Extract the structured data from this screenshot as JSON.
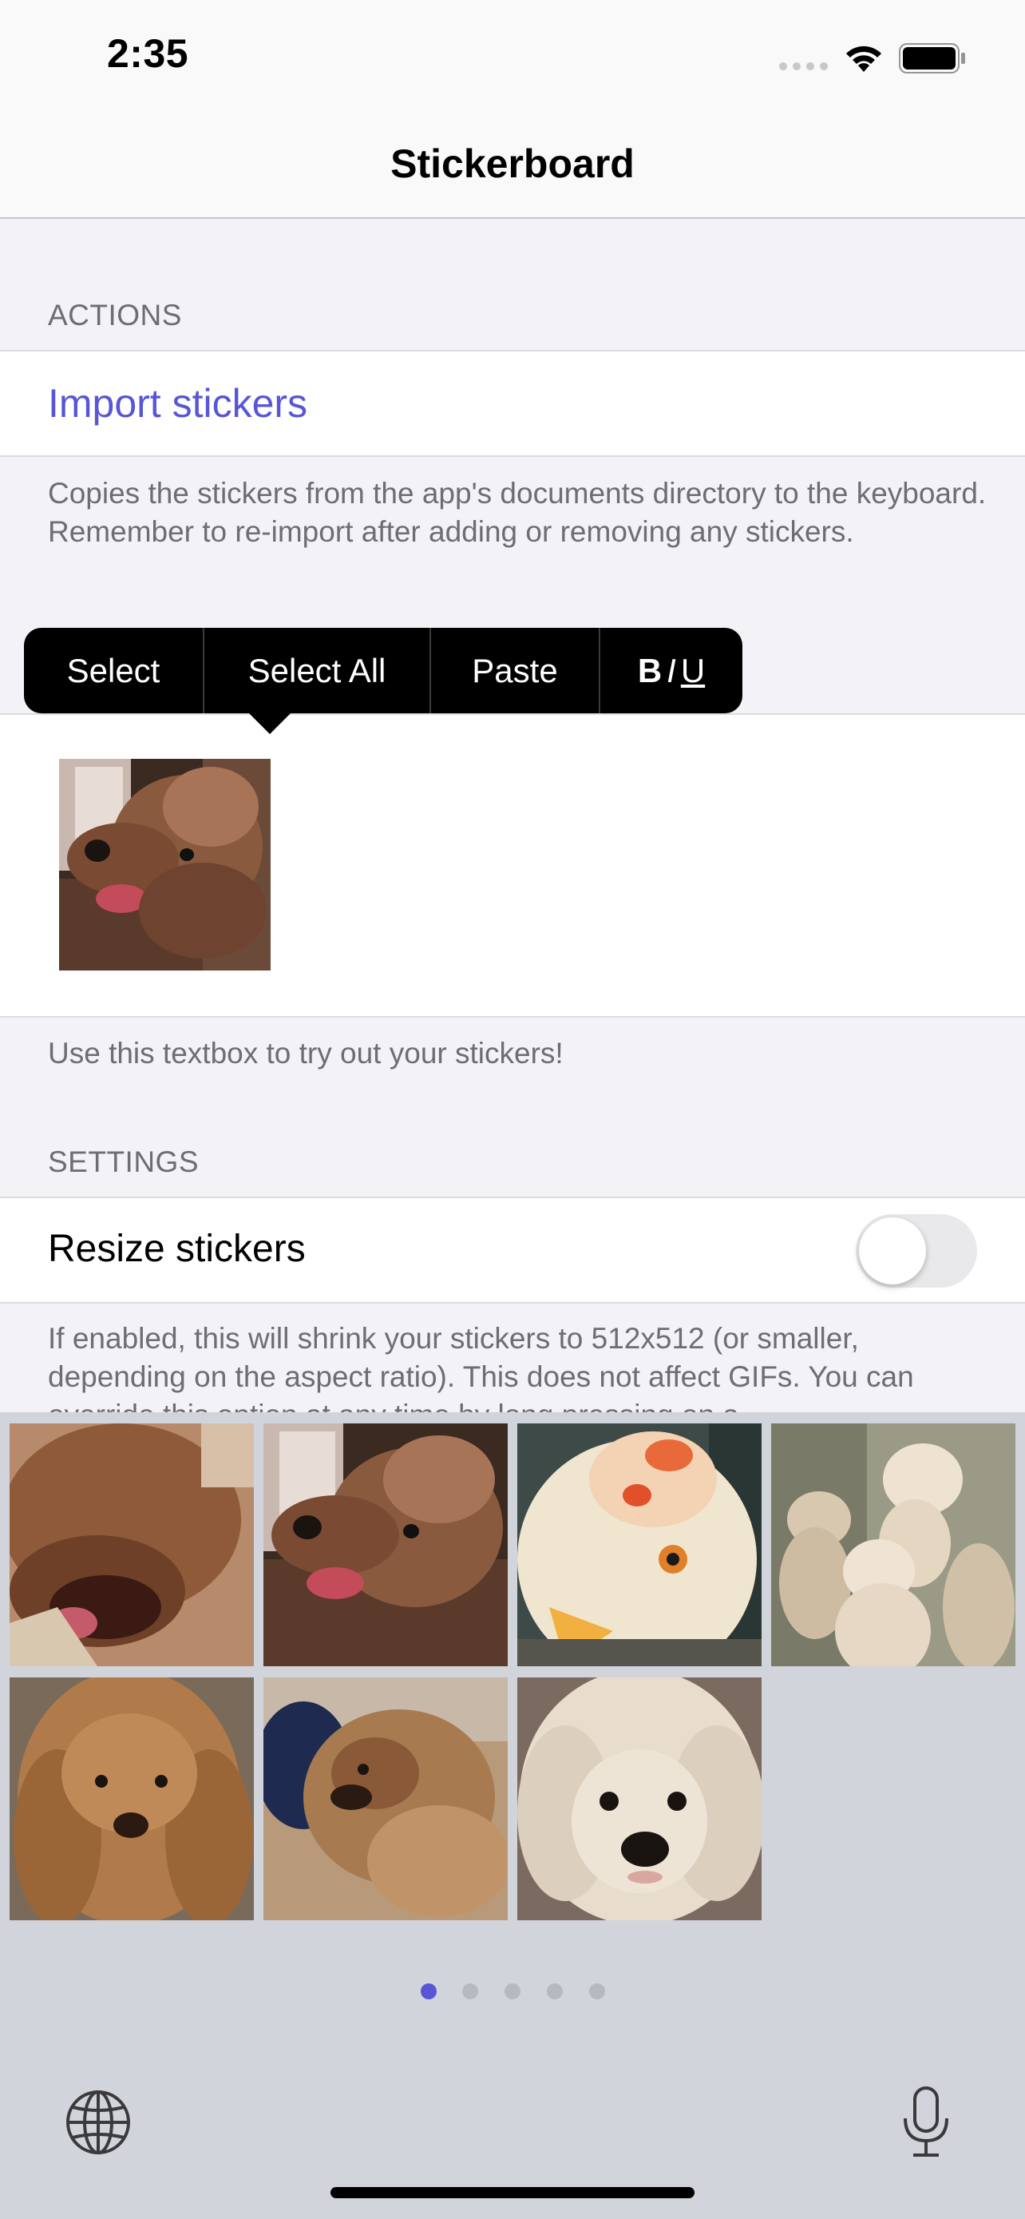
{
  "status_bar": {
    "time": "2:35",
    "icons": [
      "signal-icon",
      "wifi-icon",
      "battery-icon"
    ]
  },
  "nav": {
    "title": "Stickerboard"
  },
  "actions": {
    "header": "ACTIONS",
    "import_label": "Import stickers",
    "footer": "Copies the stickers from the app's documents directory to the keyboard. Remember to re-import after adding or removing any stickers."
  },
  "edit_menu": {
    "items": [
      "Select",
      "Select All",
      "Paste"
    ],
    "format_bold": "B",
    "format_italic": "I",
    "format_underline": "U"
  },
  "textbox": {
    "footer": "Use this textbox to try out your stickers!"
  },
  "settings": {
    "header": "SETTINGS",
    "resize_label": "Resize stickers",
    "resize_enabled": false,
    "footer": "If enabled, this will shrink your stickers to 512x512 (or smaller, depending on the aspect ratio). This does not affect GIFs. You can override this option at any time by long pressing on a"
  },
  "keyboard": {
    "stickers": [
      "poodle-yawning",
      "poodle-looking-up",
      "flowerhorn-fish",
      "poodles-group",
      "poodle-portrait",
      "poodle-blurry",
      "white-poodle-closeup"
    ],
    "page_count": 5,
    "active_page": 0
  },
  "colors": {
    "accent": "#5856d6",
    "background": "#f2f2f7",
    "keyboard_bg": "#d2d4db"
  }
}
